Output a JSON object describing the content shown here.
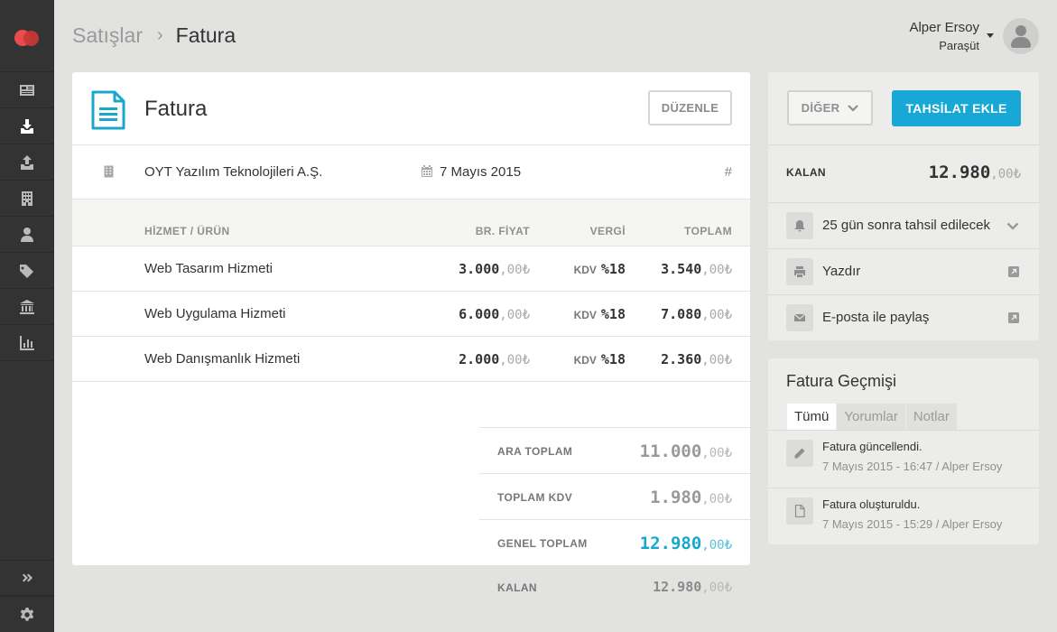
{
  "breadcrumb": {
    "parent": "Satışlar",
    "separator": "›",
    "current": "Fatura"
  },
  "user": {
    "name": "Alper Ersoy",
    "company": "Paraşüt"
  },
  "sidebar": {
    "items": [
      {
        "icon": "newspaper-icon"
      },
      {
        "icon": "download-box-icon",
        "active": true
      },
      {
        "icon": "upload-box-icon"
      },
      {
        "icon": "building-icon"
      },
      {
        "icon": "user-icon"
      },
      {
        "icon": "tags-icon"
      },
      {
        "icon": "bank-icon"
      },
      {
        "icon": "bar-chart-icon"
      }
    ],
    "bottom": [
      {
        "icon": "expand-icon"
      },
      {
        "icon": "gear-icon"
      }
    ]
  },
  "invoice": {
    "title": "Fatura",
    "edit_label": "DÜZENLE",
    "customer": "OYT Yazılım Teknolojileri A.Ş.",
    "date": "7 Mayıs 2015",
    "number_symbol": "#",
    "columns": {
      "item": "HİZMET / ÜRÜN",
      "price": "BR. FİYAT",
      "tax": "VERGİ",
      "total": "TOPLAM"
    },
    "rows": [
      {
        "name": "Web Tasarım Hizmeti",
        "price_int": "3.000",
        "price_dec": ",00₺",
        "tax_label": "KDV",
        "tax_rate": "%18",
        "total_int": "3.540",
        "total_dec": ",00₺"
      },
      {
        "name": "Web Uygulama Hizmeti",
        "price_int": "6.000",
        "price_dec": ",00₺",
        "tax_label": "KDV",
        "tax_rate": "%18",
        "total_int": "7.080",
        "total_dec": ",00₺"
      },
      {
        "name": "Web Danışmanlık Hizmeti",
        "price_int": "2.000",
        "price_dec": ",00₺",
        "tax_label": "KDV",
        "tax_rate": "%18",
        "total_int": "2.360",
        "total_dec": ",00₺"
      }
    ],
    "totals": {
      "subtotal_label": "ARA TOPLAM",
      "subtotal_int": "11.000",
      "subtotal_dec": ",00₺",
      "vat_label": "TOPLAM KDV",
      "vat_int": "1.980",
      "vat_dec": ",00₺",
      "grand_label": "GENEL TOPLAM",
      "grand_int": "12.980",
      "grand_dec": ",00₺",
      "remaining_label": "KALAN",
      "remaining_int": "12.980",
      "remaining_dec": ",00₺"
    }
  },
  "actions": {
    "other_label": "DİĞER",
    "add_payment_label": "TAHSİLAT EKLE",
    "remaining_label": "KALAN",
    "remaining_int": "12.980",
    "remaining_dec": ",00₺",
    "due_text": "25 gün sonra tahsil edilecek",
    "print_label": "Yazdır",
    "email_label": "E-posta ile paylaş"
  },
  "history": {
    "title": "Fatura Geçmişi",
    "tabs": [
      "Tümü",
      "Yorumlar",
      "Notlar"
    ],
    "items": [
      {
        "icon": "pencil-icon",
        "text": "Fatura güncellendi.",
        "meta": "7 Mayıs 2015 - 16:47 / Alper Ersoy"
      },
      {
        "icon": "document-icon",
        "text": "Fatura oluşturuldu.",
        "meta": "7 Mayıs 2015 - 15:29 / Alper Ersoy"
      }
    ]
  },
  "colors": {
    "accent": "#19a8d6",
    "sidebar": "#333333",
    "brand": "#e84c4c"
  }
}
